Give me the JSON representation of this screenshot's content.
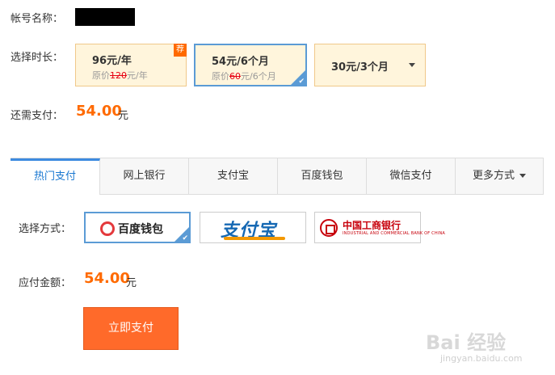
{
  "account": {
    "label": "帐号名称："
  },
  "duration": {
    "label": "选择时长：",
    "plans": [
      {
        "price": "96元/年",
        "original_prefix": "原价",
        "original_value": "120",
        "original_suffix": "元/年",
        "badge": "荐"
      },
      {
        "price": "54元/6个月",
        "original_prefix": "原价",
        "original_value": "60",
        "original_suffix": "元/6个月"
      },
      {
        "price": "30元/3个月"
      }
    ],
    "selected_index": 1
  },
  "due": {
    "label": "还需支付：",
    "amount": "54.00",
    "unit": "元"
  },
  "payment_tabs": {
    "items": [
      "热门支付",
      "网上银行",
      "支付宝",
      "百度钱包",
      "微信支付",
      "更多方式"
    ],
    "active_index": 0
  },
  "payment_method": {
    "label": "选择方式：",
    "options": [
      {
        "name": "百度钱包"
      },
      {
        "name": "支付宝"
      },
      {
        "name": "中国工商银行",
        "subtitle": "INDUSTRIAL AND COMMERCIAL BANK OF CHINA"
      }
    ],
    "selected_index": 0
  },
  "payable": {
    "label": "应付金额：",
    "amount": "54.00",
    "unit": "元"
  },
  "pay_button": {
    "label": "立即支付"
  },
  "watermark": {
    "main": "Bai 经验",
    "sub": "jingyan.baidu.com"
  },
  "colors": {
    "accent": "#ff6a00",
    "selected_border": "#5b9bd5",
    "tab_active": "#1a78d1",
    "button": "#ff6a2a"
  }
}
